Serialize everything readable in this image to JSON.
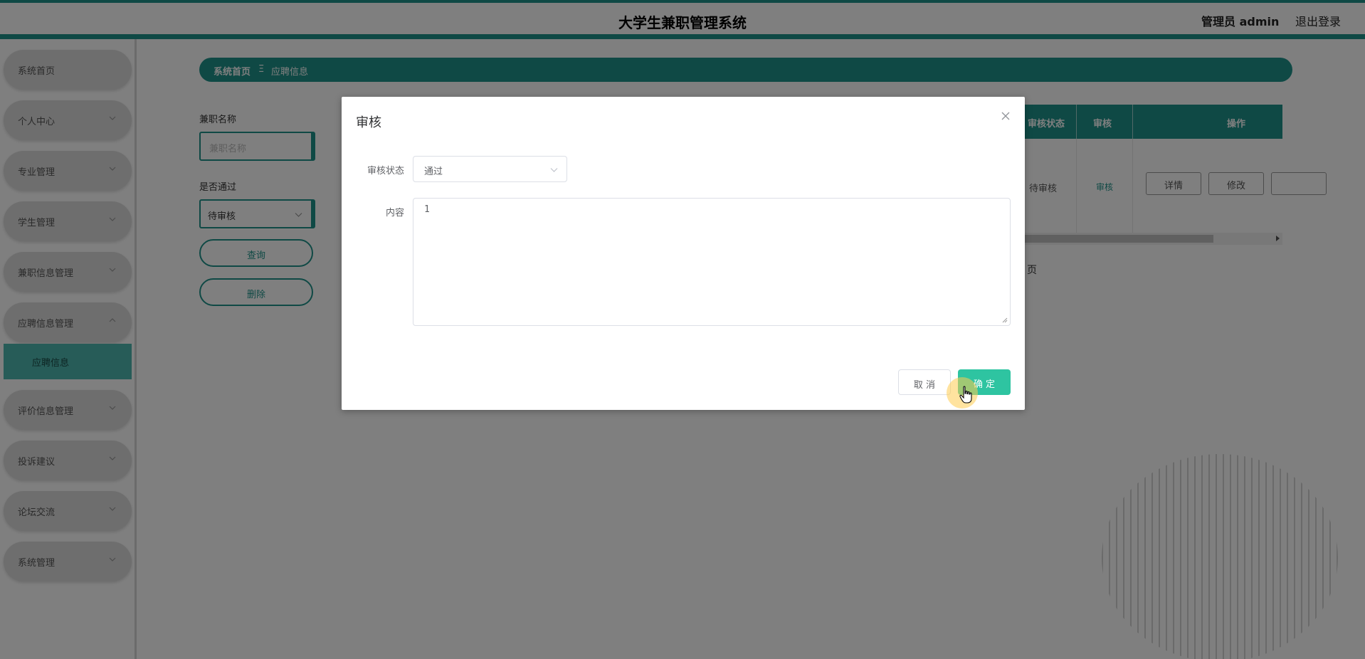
{
  "header": {
    "title": "大学生兼职管理系统",
    "user": "管理员 admin",
    "logout": "退出登录"
  },
  "sidebar": {
    "items": [
      {
        "label": "系统首页",
        "has_chevron": false
      },
      {
        "label": "个人中心",
        "has_chevron": true
      },
      {
        "label": "专业管理",
        "has_chevron": true
      },
      {
        "label": "学生管理",
        "has_chevron": true
      },
      {
        "label": "兼职信息管理",
        "has_chevron": true
      },
      {
        "label": "应聘信息管理",
        "has_chevron": true,
        "expanded": true
      },
      {
        "label": "评价信息管理",
        "has_chevron": true
      },
      {
        "label": "投诉建议",
        "has_chevron": true
      },
      {
        "label": "论坛交流",
        "has_chevron": true
      },
      {
        "label": "系统管理",
        "has_chevron": true
      }
    ],
    "subitem": "应聘信息"
  },
  "breadcrumb": {
    "home": "系统首页",
    "separator": "Ξ",
    "current": "应聘信息"
  },
  "search": {
    "name_label": "兼职名称",
    "name_placeholder": "兼职名称",
    "pass_label": "是否通过",
    "pass_value": "待审核",
    "query_button": "查询",
    "delete_button": "删除"
  },
  "table": {
    "headers": [
      "审核状态",
      "审核",
      "操作"
    ],
    "row": {
      "status": "待审核",
      "review_link": "审核",
      "buttons": [
        "详情",
        "修改"
      ]
    },
    "page_text": "页"
  },
  "dialog": {
    "title": "审核",
    "status_label": "审核状态",
    "status_value": "通过",
    "content_label": "内容",
    "content_value": "1",
    "cancel": "取 消",
    "confirm": "确 定"
  },
  "colors": {
    "primary": "#1f938a",
    "confirm": "#2ec4a1",
    "submenu": "#4fb8b0"
  }
}
